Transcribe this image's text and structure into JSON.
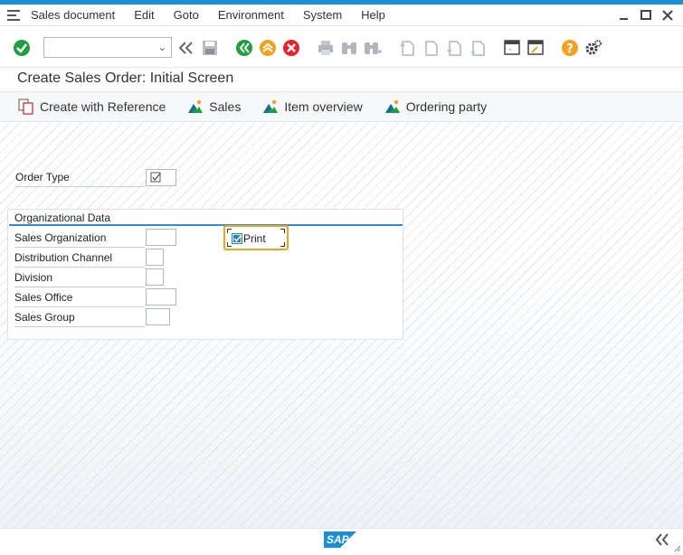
{
  "menu": {
    "items": [
      {
        "label": "Sales document"
      },
      {
        "label": "Edit"
      },
      {
        "label": "Goto"
      },
      {
        "label": "Environment"
      },
      {
        "label": "System"
      },
      {
        "label": "Help"
      }
    ]
  },
  "toolbar": {
    "command_field_value": ""
  },
  "page": {
    "title": "Create Sales Order: Initial Screen"
  },
  "app_toolbar": {
    "create_with_reference": "Create with Reference",
    "sales": "Sales",
    "item_overview": "Item overview",
    "ordering_party": "Ordering party"
  },
  "form": {
    "order_type_label": "Order Type",
    "order_type_value": "",
    "org_group_title": "Organizational Data",
    "fields": [
      {
        "label": "Sales Organization",
        "value": ""
      },
      {
        "label": "Distribution Channel",
        "value": ""
      },
      {
        "label": "Division",
        "value": ""
      },
      {
        "label": "Sales Office",
        "value": ""
      },
      {
        "label": "Sales Group",
        "value": ""
      }
    ],
    "print_label": "Print",
    "print_checked": true
  },
  "status": {
    "logo": "SAP"
  },
  "colors": {
    "accent": "#1991d2",
    "focus": "#f0a223",
    "ok_green": "#1e9e3e",
    "cancel_red": "#e0252b",
    "exit_orange": "#f0a223"
  }
}
